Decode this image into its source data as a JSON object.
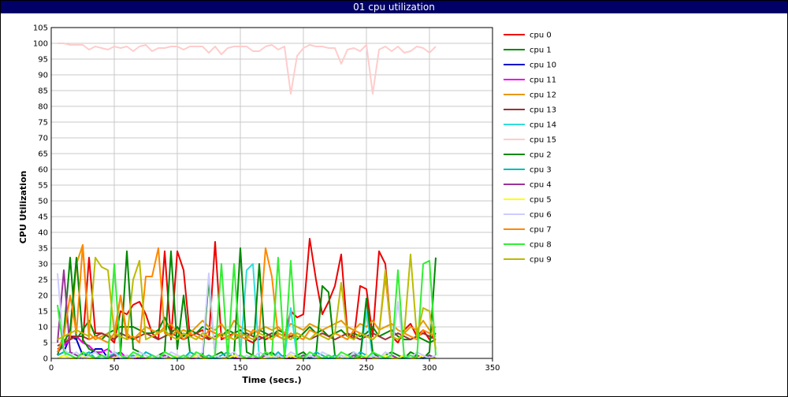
{
  "window": {
    "title": "01 cpu utilization"
  },
  "chart_data": {
    "type": "line",
    "title": "01 cpu utilization",
    "xlabel": "Time (secs.)",
    "ylabel": "CPU Utilization",
    "xlim": [
      0,
      350
    ],
    "ylim": [
      0,
      105
    ],
    "xticks": [
      0,
      50,
      100,
      150,
      200,
      250,
      300,
      350
    ],
    "yticks": [
      0,
      5,
      10,
      15,
      20,
      25,
      30,
      35,
      40,
      45,
      50,
      55,
      60,
      65,
      70,
      75,
      80,
      85,
      90,
      95,
      100,
      105
    ],
    "grid": true,
    "legend": "right",
    "x": [
      5,
      10,
      15,
      20,
      25,
      30,
      35,
      40,
      45,
      50,
      55,
      60,
      65,
      70,
      75,
      80,
      85,
      90,
      95,
      100,
      105,
      110,
      115,
      120,
      125,
      130,
      135,
      140,
      145,
      150,
      155,
      160,
      165,
      170,
      175,
      180,
      185,
      190,
      195,
      200,
      205,
      210,
      215,
      220,
      225,
      230,
      235,
      240,
      245,
      250,
      255,
      260,
      265,
      270,
      275,
      280,
      285,
      290,
      295,
      300,
      305
    ],
    "series": [
      {
        "name": "cpu 0",
        "color": "#ee0000",
        "values": [
          3,
          4,
          7,
          7,
          5,
          32,
          8,
          8,
          7,
          5,
          15,
          14,
          17,
          18,
          14,
          8,
          6,
          34,
          6,
          34,
          28,
          7,
          8,
          9,
          6,
          37,
          6,
          7,
          8,
          7,
          6,
          5,
          7,
          6,
          7,
          8,
          7,
          15,
          13,
          14,
          38,
          25,
          14,
          18,
          23,
          33,
          8,
          6,
          23,
          22,
          7,
          34,
          30,
          7,
          5,
          9,
          11,
          7,
          9,
          6,
          8
        ]
      },
      {
        "name": "cpu 1",
        "color": "#008800",
        "values": [
          1,
          8,
          32,
          6,
          9,
          12,
          7,
          6,
          8,
          9,
          10,
          10,
          10,
          9,
          8,
          8,
          9,
          13,
          8,
          10,
          7,
          9,
          8,
          10,
          9,
          8,
          7,
          9,
          8,
          9,
          7,
          8,
          9,
          8,
          7,
          9,
          8,
          7,
          6,
          8,
          10,
          8,
          9,
          7,
          8,
          9,
          7,
          8,
          7,
          8,
          10,
          7,
          8,
          9,
          7,
          6,
          6,
          7,
          6,
          5,
          6
        ]
      },
      {
        "name": "cpu 10",
        "color": "#0000cc",
        "values": [
          1,
          2,
          7,
          6,
          1,
          1,
          3,
          3,
          0,
          0,
          0,
          0,
          0,
          0,
          0,
          0,
          0,
          0,
          0,
          0,
          0,
          0,
          0,
          0,
          0,
          0,
          0,
          0,
          0,
          0,
          0,
          0,
          0,
          0,
          0,
          0,
          0,
          0,
          0,
          0,
          0,
          0,
          0,
          0,
          0,
          0,
          0,
          0,
          0,
          0,
          0,
          0,
          0,
          0,
          0,
          0,
          0,
          0,
          0,
          0,
          0
        ]
      },
      {
        "name": "cpu 11",
        "color": "#ee00ee",
        "values": [
          2,
          4,
          6,
          7,
          5,
          4,
          2,
          2,
          3,
          1,
          2,
          0,
          0,
          0,
          0,
          0,
          0,
          0,
          0,
          0,
          0,
          0,
          0,
          0,
          0,
          0,
          0,
          0,
          0,
          0,
          0,
          0,
          0,
          0,
          0,
          0,
          0,
          0,
          0,
          0,
          0,
          0,
          0,
          0,
          0,
          0,
          0,
          0,
          0,
          0,
          0,
          0,
          0,
          0,
          0,
          0,
          0,
          0,
          0,
          0,
          0
        ]
      },
      {
        "name": "cpu 12",
        "color": "#e69900",
        "values": [
          2,
          6,
          6,
          30,
          36,
          8,
          6,
          7,
          8,
          6,
          20,
          8,
          6,
          8,
          10,
          9,
          8,
          10,
          11,
          8,
          9,
          8,
          10,
          12,
          10,
          9,
          11,
          8,
          12,
          10,
          9,
          8,
          9,
          10,
          9,
          10,
          8,
          11,
          10,
          9,
          11,
          10,
          9,
          10,
          11,
          12,
          10,
          9,
          11,
          10,
          12,
          9,
          10,
          11,
          9,
          8,
          10,
          9,
          12,
          9,
          10
        ]
      },
      {
        "name": "cpu 13",
        "color": "#993333",
        "values": [
          4,
          5,
          6,
          7,
          7,
          6,
          7,
          8,
          7,
          6,
          8,
          7,
          6,
          7,
          8,
          7,
          6,
          7,
          8,
          7,
          6,
          7,
          8,
          7,
          6,
          7,
          8,
          7,
          6,
          7,
          8,
          7,
          6,
          7,
          8,
          7,
          6,
          7,
          8,
          7,
          6,
          7,
          8,
          7,
          6,
          7,
          8,
          7,
          6,
          7,
          8,
          7,
          6,
          7,
          8,
          7,
          6,
          7,
          8,
          7,
          6
        ]
      },
      {
        "name": "cpu 14",
        "color": "#33dddd",
        "values": [
          0,
          1,
          2,
          1,
          0,
          1,
          0,
          0,
          0,
          1,
          0,
          0,
          0,
          1,
          0,
          0,
          0,
          0,
          0,
          0,
          0,
          1,
          0,
          0,
          0,
          0,
          0,
          0,
          0,
          1,
          28,
          30,
          0,
          0,
          0,
          0,
          0,
          16,
          0,
          0,
          0,
          0,
          0,
          0,
          0,
          0,
          0,
          0,
          0,
          15,
          0,
          0,
          0,
          0,
          0,
          0,
          0,
          0,
          0,
          0,
          0
        ]
      },
      {
        "name": "cpu 15",
        "color": "#ffcccc",
        "values": [
          100,
          100,
          99.5,
          99.5,
          99.5,
          98,
          99,
          98.5,
          98,
          99,
          98.5,
          99,
          97.5,
          99,
          99.5,
          97.5,
          98.5,
          98.5,
          99,
          99,
          98,
          99,
          99,
          99,
          97,
          99,
          96.5,
          98.5,
          99,
          99,
          99,
          97.5,
          97.5,
          99,
          99.5,
          98,
          99,
          84,
          96,
          98.5,
          99.5,
          99,
          99,
          98.5,
          98.5,
          93.5,
          98,
          98.5,
          97.5,
          99.5,
          84,
          98,
          99,
          97.5,
          99,
          97,
          97.5,
          99,
          98.5,
          97,
          99
        ]
      },
      {
        "name": "cpu 2",
        "color": "#008800",
        "values": [
          2,
          5,
          9,
          32,
          6,
          3,
          2,
          1,
          0,
          1,
          2,
          34,
          3,
          2,
          1,
          0,
          1,
          2,
          34,
          3,
          20,
          2,
          1,
          0,
          25,
          1,
          2,
          0,
          1,
          35,
          2,
          1,
          30,
          1,
          2,
          0,
          1,
          0,
          1,
          2,
          0,
          1,
          23,
          21,
          1,
          0,
          1,
          2,
          0,
          19,
          2,
          0,
          1,
          2,
          1,
          0,
          2,
          1,
          0,
          2,
          32
        ]
      },
      {
        "name": "cpu 3",
        "color": "#00bbbb",
        "values": [
          1,
          2,
          1,
          0,
          1,
          2,
          0,
          1,
          0,
          2,
          1,
          0,
          1,
          0,
          2,
          1,
          0,
          1,
          0,
          1,
          0,
          2,
          1,
          0,
          1,
          0,
          1,
          2,
          0,
          1,
          0,
          1,
          0,
          1,
          0,
          2,
          0,
          1,
          0,
          1,
          0,
          2,
          1,
          0,
          1,
          0,
          1,
          0,
          2,
          1,
          0,
          1,
          0,
          1,
          0,
          1,
          0,
          1,
          0,
          1,
          0
        ]
      },
      {
        "name": "cpu 4",
        "color": "#993399",
        "values": [
          5,
          28,
          2,
          1,
          0,
          1,
          0,
          1,
          0,
          1,
          0,
          1,
          0,
          1,
          0,
          1,
          0,
          1,
          0,
          1,
          0,
          1,
          0,
          1,
          0,
          1,
          0,
          1,
          0,
          1,
          0,
          1,
          0,
          1,
          0,
          1,
          0,
          1,
          0,
          1,
          0,
          1,
          0,
          1,
          0,
          1,
          0,
          1,
          0,
          1,
          0,
          1,
          0,
          1,
          0,
          1,
          0,
          1,
          0,
          1,
          0
        ]
      },
      {
        "name": "cpu 5",
        "color": "#ffff00",
        "values": [
          0,
          1,
          0,
          0,
          1,
          0,
          0,
          1,
          0,
          0,
          1,
          0,
          0,
          1,
          0,
          0,
          1,
          0,
          0,
          1,
          0,
          0,
          1,
          0,
          0,
          1,
          0,
          0,
          1,
          0,
          0,
          1,
          0,
          0,
          1,
          0,
          0,
          1,
          0,
          0,
          1,
          0,
          0,
          1,
          0,
          0,
          1,
          0,
          0,
          1,
          0,
          0,
          1,
          0,
          0,
          1,
          0,
          0,
          1,
          0,
          0
        ]
      },
      {
        "name": "cpu 6",
        "color": "#ccccff",
        "values": [
          27,
          3,
          1,
          2,
          0,
          1,
          2,
          0,
          1,
          2,
          0,
          1,
          0,
          2,
          1,
          0,
          1,
          0,
          2,
          1,
          0,
          1,
          0,
          2,
          27,
          1,
          0,
          1,
          2,
          0,
          1,
          0,
          2,
          1,
          0,
          1,
          0,
          2,
          1,
          0,
          1,
          0,
          2,
          1,
          0,
          1,
          0,
          2,
          1,
          0,
          1,
          0,
          2,
          1,
          18,
          1,
          0,
          2,
          1,
          0,
          1
        ]
      },
      {
        "name": "cpu 7",
        "color": "#ff8800",
        "values": [
          2,
          7,
          20,
          8,
          36,
          6,
          7,
          6,
          5,
          8,
          20,
          6,
          7,
          5,
          26,
          26,
          35,
          8,
          7,
          9,
          6,
          8,
          7,
          6,
          9,
          8,
          7,
          6,
          8,
          7,
          6,
          9,
          8,
          35,
          26,
          7,
          6,
          8,
          7,
          6,
          9,
          8,
          7,
          6,
          8,
          7,
          6,
          9,
          8,
          7,
          6,
          8,
          26,
          7,
          6,
          8,
          7,
          6,
          9,
          8,
          7
        ]
      },
      {
        "name": "cpu 8",
        "color": "#33ee33",
        "values": [
          17,
          2,
          1,
          0,
          2,
          1,
          0,
          1,
          0,
          30,
          1,
          0,
          2,
          1,
          0,
          1,
          0,
          2,
          1,
          0,
          1,
          0,
          2,
          1,
          0,
          1,
          30,
          0,
          30,
          1,
          0,
          1,
          0,
          2,
          1,
          32,
          0,
          31,
          1,
          0,
          2,
          1,
          0,
          1,
          0,
          2,
          1,
          0,
          1,
          0,
          2,
          1,
          0,
          1,
          28,
          0,
          1,
          0,
          30,
          31,
          1
        ]
      },
      {
        "name": "cpu 9",
        "color": "#bbbb00",
        "values": [
          6,
          7,
          8,
          9,
          8,
          7,
          32,
          29,
          28,
          8,
          7,
          6,
          25,
          31,
          6,
          7,
          8,
          9,
          7,
          6,
          8,
          7,
          6,
          8,
          7,
          6,
          8,
          7,
          6,
          8,
          7,
          6,
          8,
          7,
          6,
          8,
          7,
          6,
          8,
          7,
          6,
          8,
          7,
          6,
          8,
          24,
          7,
          6,
          8,
          7,
          6,
          8,
          28,
          7,
          6,
          8,
          33,
          7,
          16,
          15,
          3
        ]
      }
    ]
  }
}
